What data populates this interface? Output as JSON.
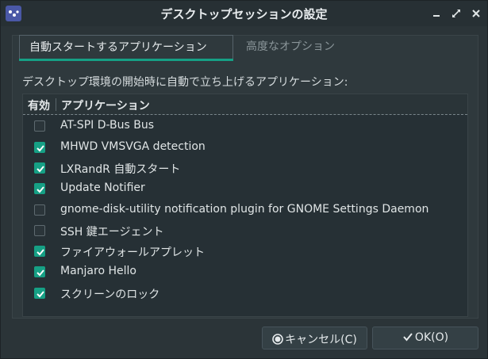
{
  "window": {
    "title": "デスクトップセッションの設定"
  },
  "tabs": [
    {
      "label": "自動スタートするアプリケーション",
      "active": true
    },
    {
      "label": "高度なオプション",
      "active": false
    }
  ],
  "section_label": "デスクトップ環境の開始時に自動で立ち上げるアプリケーション:",
  "list": {
    "columns": {
      "enabled": "有効",
      "application": "アプリケーション"
    },
    "items": [
      {
        "label": "Update Notifier",
        "checked": false
      },
      {
        "label": "AT-SPI D-Bus Bus",
        "checked": false
      },
      {
        "label": "MHWD VMSVGA detection",
        "checked": true
      },
      {
        "label": "LXRandR 自動スタート",
        "checked": true
      },
      {
        "label": "Update Notifier",
        "checked": true
      },
      {
        "label": "gnome-disk-utility notification plugin for GNOME Settings Daemon",
        "checked": false
      },
      {
        "label": "SSH 鍵エージェント",
        "checked": false
      },
      {
        "label": "ファイアウォールアプレット",
        "checked": true
      },
      {
        "label": "Manjaro Hello",
        "checked": true
      },
      {
        "label": "スクリーンのロック",
        "checked": true
      }
    ]
  },
  "buttons": {
    "cancel": "キャンセル(C)",
    "ok": "OK(O)"
  },
  "colors": {
    "accent": "#16a085",
    "background": "#2b3438"
  }
}
